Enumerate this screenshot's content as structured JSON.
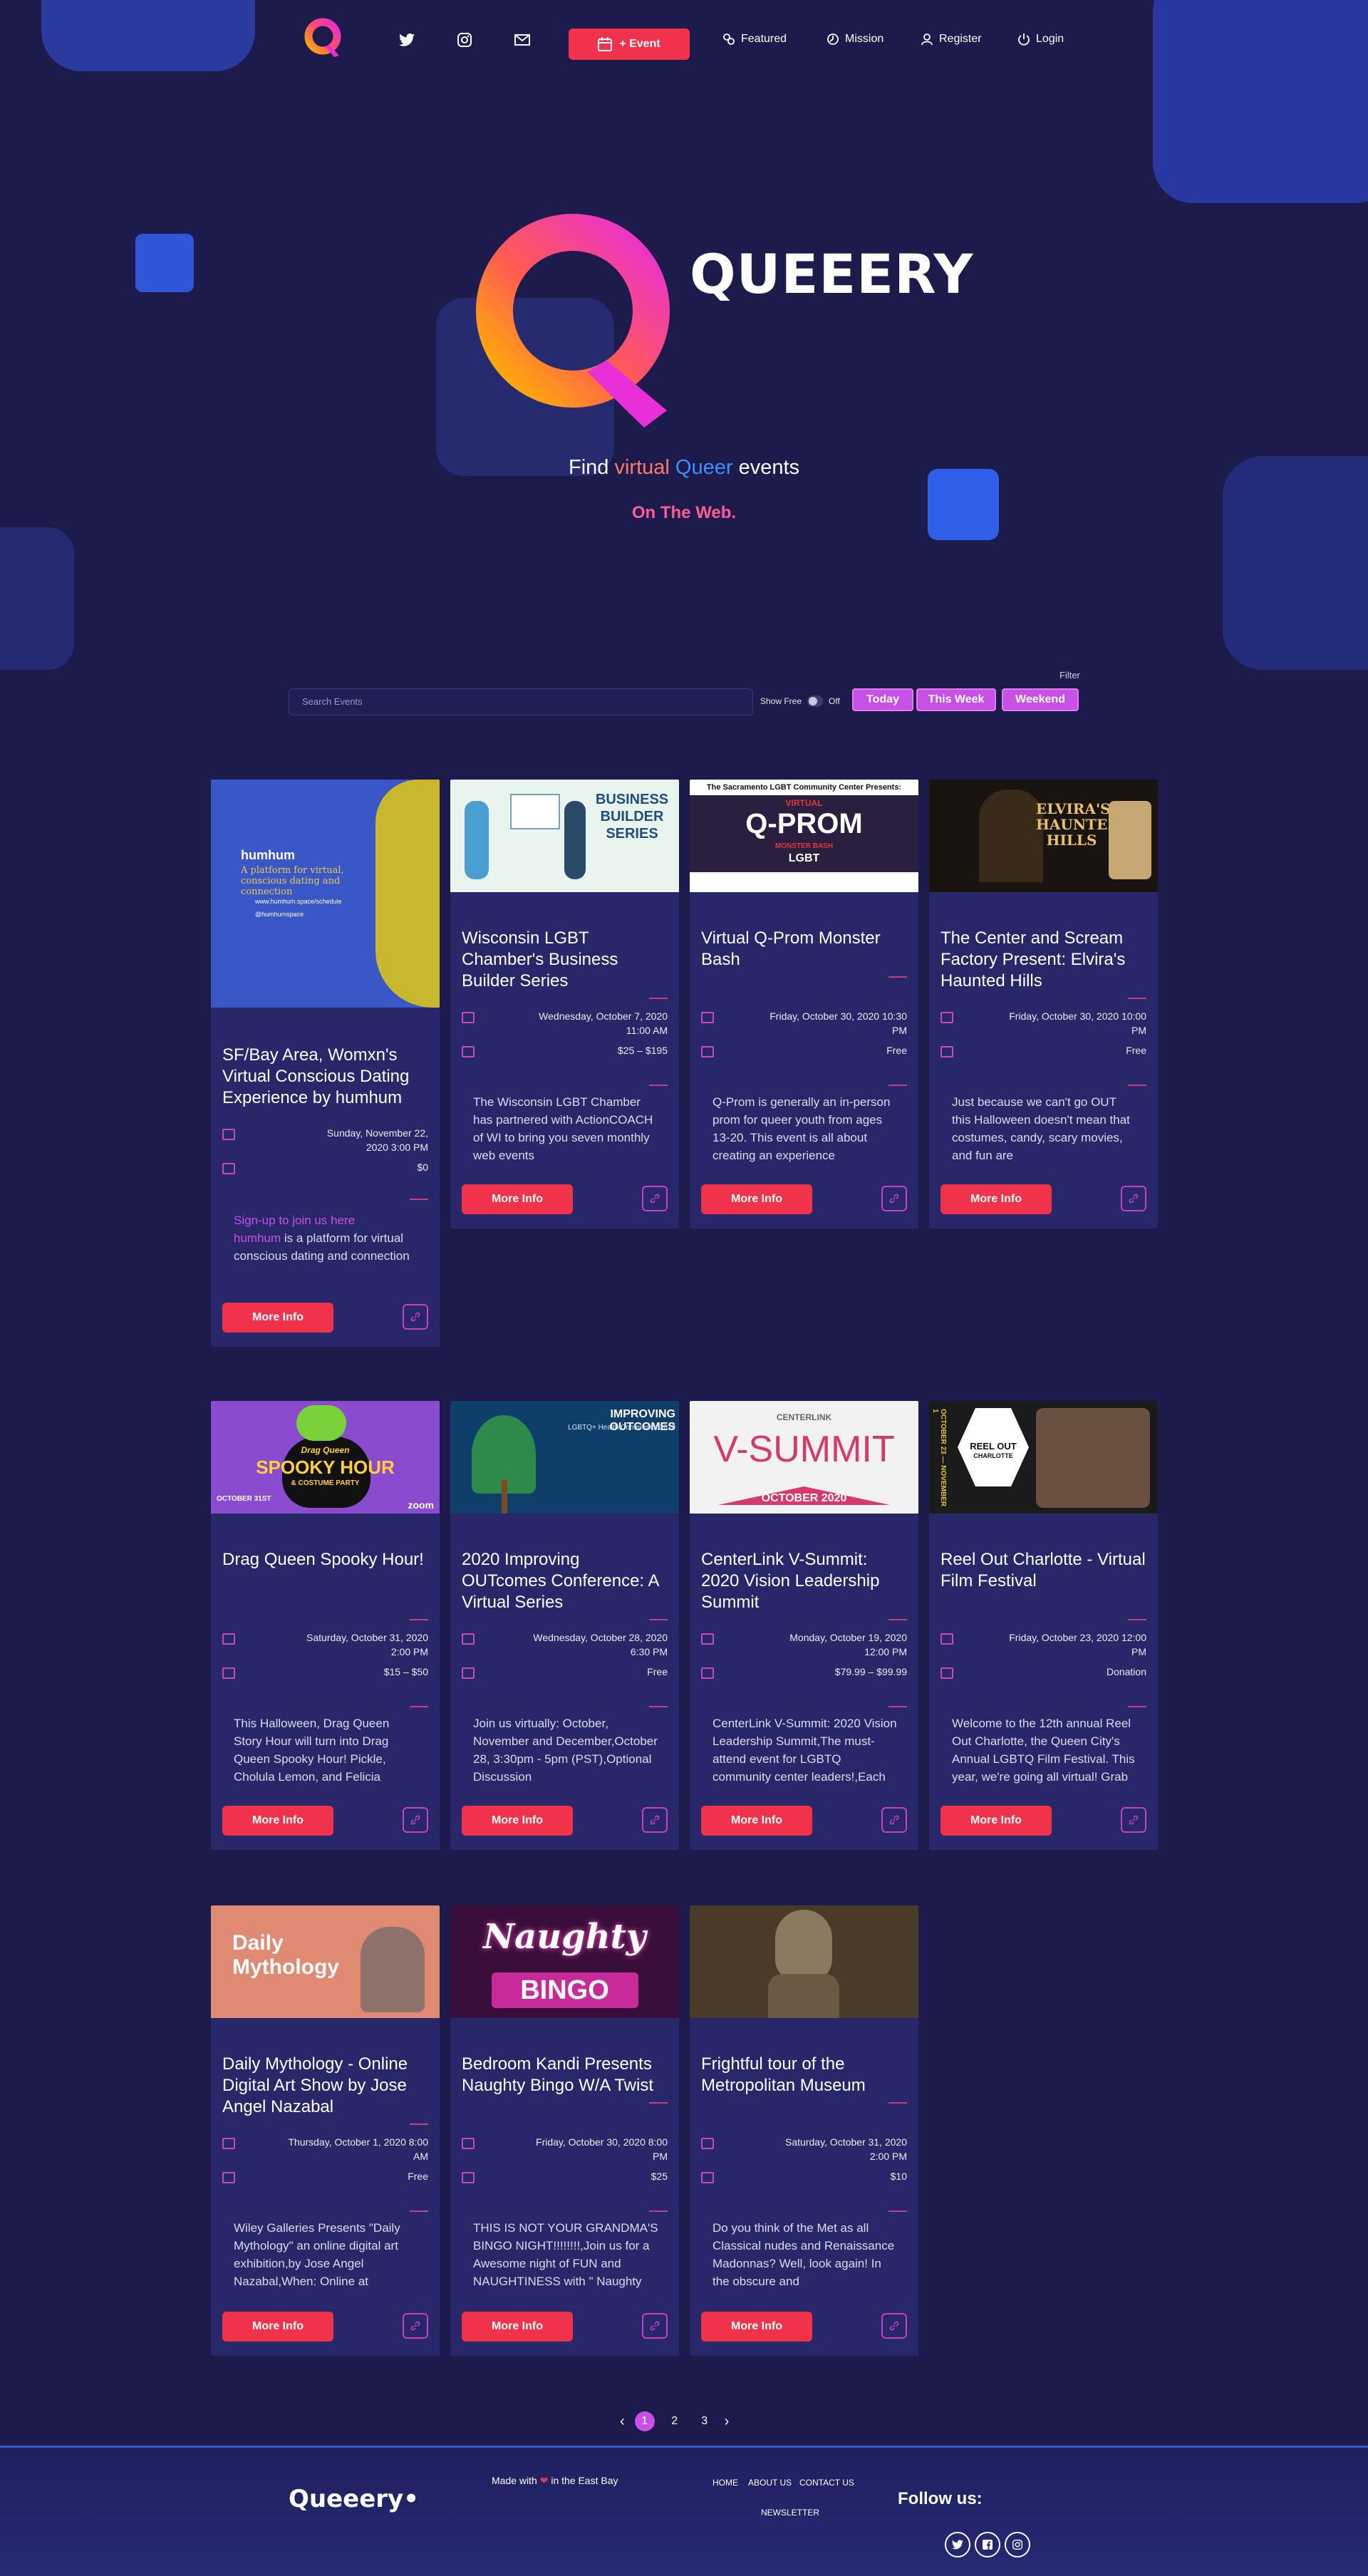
{
  "nav": {
    "event_label": "+ Event",
    "featured": "Featured",
    "mission": "Mission",
    "register": "Register",
    "login": "Login"
  },
  "hero": {
    "brand": "QUEEERY",
    "find": "Find",
    "virtual": "virtual",
    "queer": "Queer",
    "events": "events",
    "sub": "On The Web."
  },
  "search": {
    "filter": "Filter",
    "placeholder": "Search Events",
    "show_free": "Show Free",
    "off": "Off",
    "today": "Today",
    "this_week": "This Week",
    "weekend": "Weekend"
  },
  "cards": [
    {
      "title": "SF/Bay Area, Womxn's Virtual Conscious Dating Experience by humhum",
      "date": "Sunday, November 22, 2020 3:00 PM",
      "price": "$0",
      "desc_link": "Sign-up to join us here",
      "desc_brand": "humhum",
      "desc": " is a platform for virtual conscious dating and connection— this particular",
      "more": "More Info",
      "img_text": "humhum",
      "img_sub": "A platform for virtual, conscious dating and connection",
      "img_info1": "www.humhum.space/schedule",
      "img_info2": "@humhumspace"
    },
    {
      "title": "Wisconsin LGBT Chamber's Business Builder Series",
      "date": "Wednesday, October 7, 2020 11:00 AM",
      "price": "$25 – $195",
      "desc": "The Wisconsin LGBT Chamber has partnered with ActionCOACH of WI to bring you seven monthly web events",
      "more": "More Info",
      "img_text": "BUSINESS BUILDER SERIES"
    },
    {
      "title": "Virtual Q-Prom Monster Bash",
      "date": "Friday, October 30, 2020 10:30 PM",
      "price": "Free",
      "desc": "Q-Prom is generally an in-person prom for queer youth from ages 13-20. This event is all about creating an experience",
      "more": "More Info",
      "img_top": "The Sacramento LGBT Community Center Presents:",
      "img_text": "Q-PROM",
      "img_sub": "VIRTUAL",
      "img_sub2": "MONSTER BASH",
      "img_sub3": "LGBT"
    },
    {
      "title": "The Center and Scream Factory Present: Elvira's Haunted Hills",
      "date": "Friday, October 30, 2020 10:00 PM",
      "price": "Free",
      "desc": "Just because we can't go OUT this Halloween doesn't mean that costumes, candy, scary movies, and fun are",
      "more": "More Info",
      "img_text": "ELVIRA'S HAUNTED HILLS"
    },
    {
      "title": "Drag Queen Spooky Hour!",
      "date": "Saturday, October 31, 2020 2:00 PM",
      "price": "$15 – $50",
      "desc": "This Halloween, Drag Queen Story Hour will turn into Drag Queen Spooky Hour! Pickle, Cholula Lemon, and Felicia",
      "more": "More Info",
      "img_sub": "Drag Queen",
      "img_text": "SPOOKY HOUR",
      "img_sub2": "& COSTUME PARTY",
      "img_date": "OCTOBER 31ST",
      "img_zoom": "zoom"
    },
    {
      "title": "2020 Improving OUTcomes Conference: A Virtual Series",
      "date": "Wednesday, October 28, 2020 6:30 PM",
      "price": "Free",
      "desc": "Join us virtually: October, November and December,October 28, 3:30pm - 5pm (PST),Optional Discussion",
      "more": "More Info",
      "img_text": "IMPROVING OUTCOMES",
      "img_sub": "LGBTQ+ Health Conference 2020"
    },
    {
      "title": "CenterLink V-Summit: 2020 Vision Leadership Summit",
      "date": "Monday, October 19, 2020 12:00 PM",
      "price": "$79.99 – $99.99",
      "desc": "CenterLink V-Summit: 2020 Vision Leadership Summit,The must-attend event for LGBTQ community center leaders!,Each",
      "more": "More Info",
      "img_top": "CENTERLINK",
      "img_text": "V-SUMMIT",
      "img_sub": "OCTOBER 2020"
    },
    {
      "title": "Reel Out Charlotte - Virtual Film Festival",
      "date": "Friday, October 23, 2020 12:00 PM",
      "price": "Donation",
      "desc": "Welcome to the 12th annual Reel Out Charlotte, the Queen City's Annual LGBTQ Film Festival. This year, we're going all virtual! Grab",
      "more": "More Info",
      "img_text": "REEL OUT",
      "img_sub": "CHARLOTTE",
      "img_side": "OCTOBER 23 — NOVEMBER 1"
    },
    {
      "title": "Daily Mythology - Online Digital Art Show by Jose Angel Nazabal",
      "date": "Thursday, October 1, 2020 8:00 AM",
      "price": "Free",
      "desc": "Wiley Galleries Presents \"Daily Mythology\" an online digital art exhibition,by Jose Angel Nazabal,When: Online at",
      "more": "More Info",
      "img_text": "Daily Mythology"
    },
    {
      "title": "Bedroom Kandi Presents Naughty Bingo W/A Twist",
      "date": "Friday, October 30, 2020 8:00 PM",
      "price": "$25",
      "desc": "THIS IS NOT YOUR GRANDMA'S BINGO NIGHT!!!!!!!!,Join us for a Awesome night of FUN and NAUGHTINESS with \" Naughty",
      "more": "More Info",
      "img_text": "Naughty",
      "img_sub": "BINGO"
    },
    {
      "title": "Frightful tour of the Metropolitan Museum",
      "date": "Saturday, October 31, 2020 2:00 PM",
      "price": "$10",
      "desc": "Do you think of the Met as all Classical nudes and Renaissance Madonnas? Well, look again! In the obscure and",
      "more": "More Info"
    }
  ],
  "pagination": {
    "p1": "1",
    "p2": "2",
    "p3": "3"
  },
  "footer": {
    "logo": "Queeery•",
    "made_with": "Made with",
    "in_east_bay": "in the East Bay",
    "home": "HOME",
    "about": "ABOUT US",
    "contact": "CONTACT US",
    "newsletter": "NEWSLETTER",
    "follow": "Follow us:"
  }
}
